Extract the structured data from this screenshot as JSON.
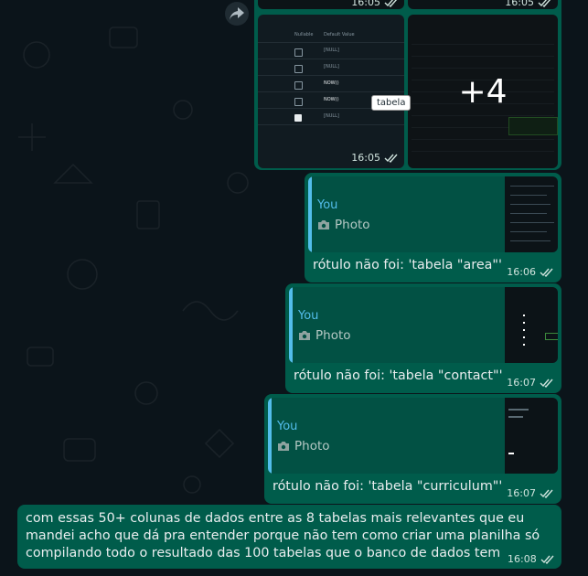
{
  "media_group": {
    "time_top_left": "16:05",
    "time_top_right": "16:05",
    "time_bottom_left": "16:05",
    "more_count": "+4",
    "tooltip": "tabela",
    "thumb1_headers": [
      "Nullable",
      "Default Value"
    ],
    "thumb1_values": [
      "[NULL]",
      "[NULL]",
      "NOW()",
      "NOW()",
      "[NULL]"
    ]
  },
  "replies": [
    {
      "author": "You",
      "type": "Photo",
      "text": "rótulo não foi: 'tabela \"area\"'",
      "time": "16:06"
    },
    {
      "author": "You",
      "type": "Photo",
      "text": "rótulo não foi: 'tabela \"contact\"'",
      "time": "16:07"
    },
    {
      "author": "You",
      "type": "Photo",
      "text": "rótulo não foi: 'tabela \"curriculum\"'",
      "time": "16:07"
    }
  ],
  "last_message": {
    "text": "com essas 50+ colunas de dados entre as 8 tabelas mais relevantes que eu mandei acho que dá pra entender porque não tem como criar uma planilha só compilando todo o resultado das 100 tabelas que o banco de dados tem",
    "time": "16:08"
  },
  "colors": {
    "bubble": "#005c4b",
    "quote_bar": "#53bdeb",
    "background": "#0b141a"
  }
}
